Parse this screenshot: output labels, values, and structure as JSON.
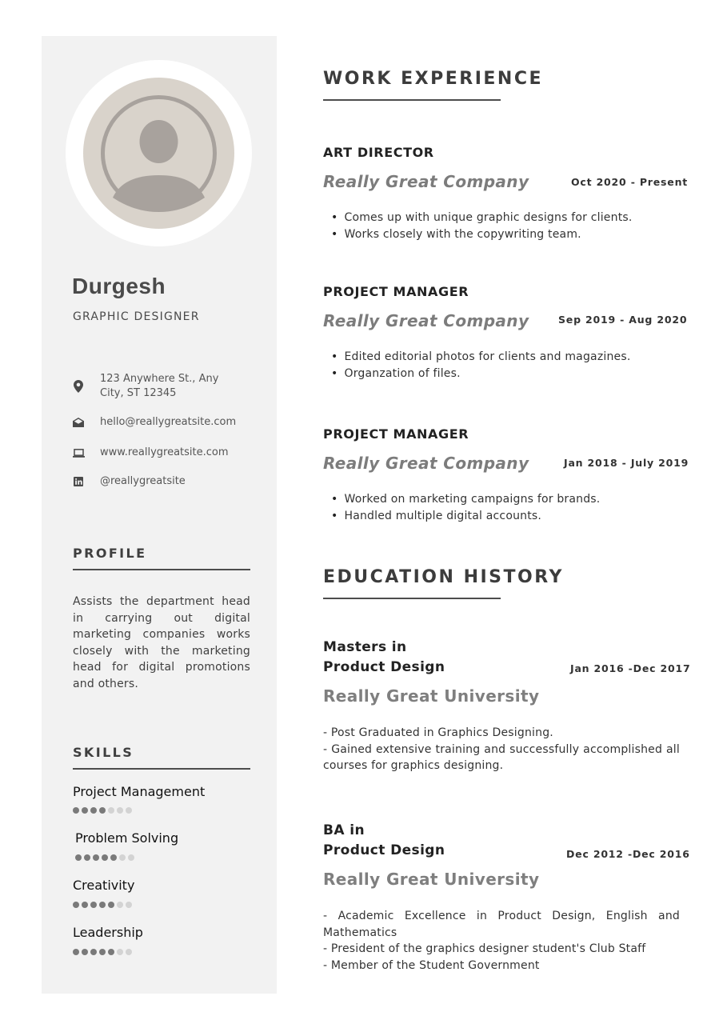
{
  "person": {
    "name": "Durgesh",
    "role": "GRAPHIC DESIGNER"
  },
  "contact": {
    "address": "123 Anywhere St., Any City, ST 12345",
    "email": "hello@reallygreatsite.com",
    "website": "www.reallygreatsite.com",
    "social": "@reallygreatsite"
  },
  "profile": {
    "heading": "PROFILE",
    "text": "Assists the department head in carrying out digital marketing companies works closely with the marketing head for digital promotions and others."
  },
  "skills": {
    "heading": "SKILLS",
    "items": [
      {
        "name": "Project Management",
        "level": 4,
        "max": 7
      },
      {
        "name": "Problem Solving",
        "level": 5,
        "max": 7
      },
      {
        "name": "Creativity",
        "level": 5,
        "max": 7
      },
      {
        "name": "Leadership",
        "level": 5,
        "max": 7
      }
    ]
  },
  "work": {
    "heading": "WORK EXPERIENCE",
    "jobs": [
      {
        "title": "ART DIRECTOR",
        "company": "Really Great Company",
        "dates": "Oct 2020 - Present",
        "bullets": [
          "Comes up with unique graphic designs for clients.",
          "Works closely with the copywriting team."
        ]
      },
      {
        "title": "PROJECT MANAGER",
        "company": "Really Great Company",
        "dates": "Sep 2019 - Aug 2020",
        "bullets": [
          "Edited editorial photos for clients and magazines.",
          "Organzation of files."
        ]
      },
      {
        "title": "PROJECT MANAGER",
        "company": "Really Great Company",
        "dates": "Jan 2018 - July 2019",
        "bullets": [
          "Worked on marketing campaigns for brands.",
          "Handled multiple digital accounts."
        ]
      }
    ]
  },
  "education": {
    "heading": "EDUCATION HISTORY",
    "entries": [
      {
        "degree_line1": "Masters in",
        "degree_line2": "Product Design",
        "dates": "Jan 2016 -Dec 2017",
        "school": "Really Great University",
        "lines": [
          "- Post Graduated in Graphics Designing.",
          "- Gained extensive training and successfully accomplished all courses for graphics designing."
        ]
      },
      {
        "degree_line1": "BA in",
        "degree_line2": "Product Design",
        "dates": "Dec 2012 -Dec 2016",
        "school": "Really Great University",
        "lines": [
          "- Academic Excellence in Product Design, English and Mathematics",
          "- President of the graphics designer student's Club Staff",
          "- Member of the Student Government"
        ]
      }
    ]
  },
  "icons": [
    "user-avatar-icon",
    "location-pin-icon",
    "envelope-icon",
    "laptop-icon",
    "linkedin-icon"
  ],
  "colors": {
    "sidebar_bg": "#f2f2f2",
    "avatar_bg": "#d9d3cb",
    "avatar_figure": "#a8a29d",
    "dot_on": "#7a7a7a",
    "dot_off": "#d3d3d3"
  }
}
